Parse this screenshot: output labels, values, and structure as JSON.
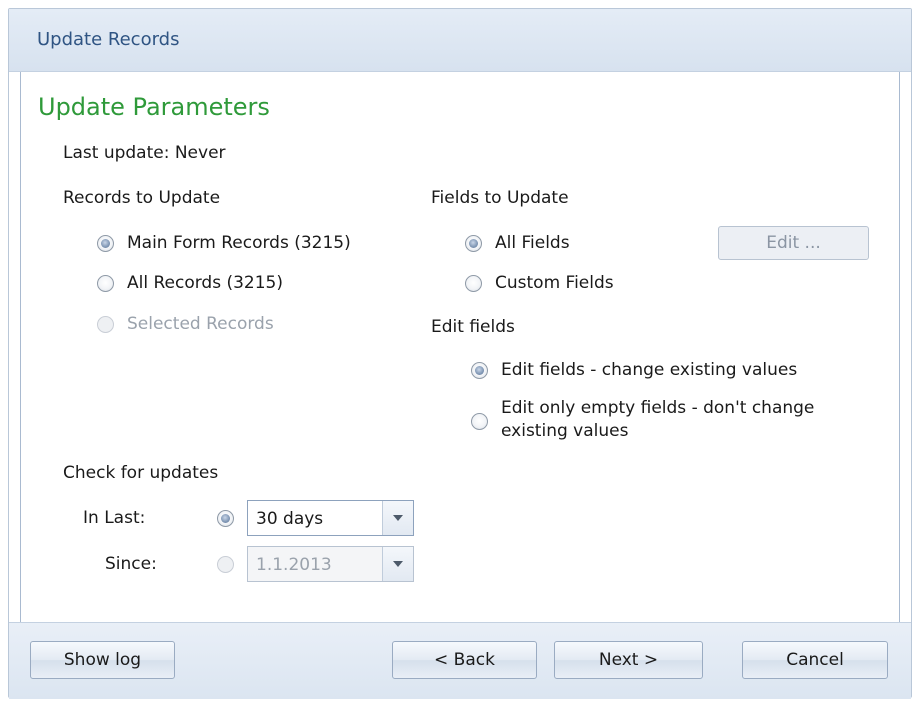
{
  "window": {
    "title": "Update Records"
  },
  "section": {
    "title": "Update Parameters"
  },
  "last_update": {
    "text": "Last update: Never"
  },
  "records": {
    "heading": "Records to Update",
    "options": [
      {
        "label": "Main Form Records (3215)",
        "checked": true,
        "enabled": true
      },
      {
        "label": "All Records (3215)",
        "checked": false,
        "enabled": true
      },
      {
        "label": "Selected Records",
        "checked": false,
        "enabled": false
      }
    ]
  },
  "fields": {
    "heading": "Fields to Update",
    "options": [
      {
        "label": "All Fields",
        "checked": true
      },
      {
        "label": "Custom Fields",
        "checked": false
      }
    ],
    "edit_button": "Edit ..."
  },
  "edit_fields": {
    "heading": "Edit fields",
    "options": [
      {
        "label": "Edit fields - change existing values",
        "checked": true
      },
      {
        "label_line1": "Edit only empty fields - don't change",
        "label_line2": "existing values",
        "checked": false
      }
    ]
  },
  "check_updates": {
    "heading": "Check for updates",
    "in_last": {
      "label": "In Last:",
      "value": "30 days",
      "checked": true
    },
    "since": {
      "label": "Since:",
      "value": "1.1.2013",
      "checked": false
    }
  },
  "footer": {
    "show_log": "Show log",
    "back": "< Back",
    "next": "Next >",
    "cancel": "Cancel"
  }
}
